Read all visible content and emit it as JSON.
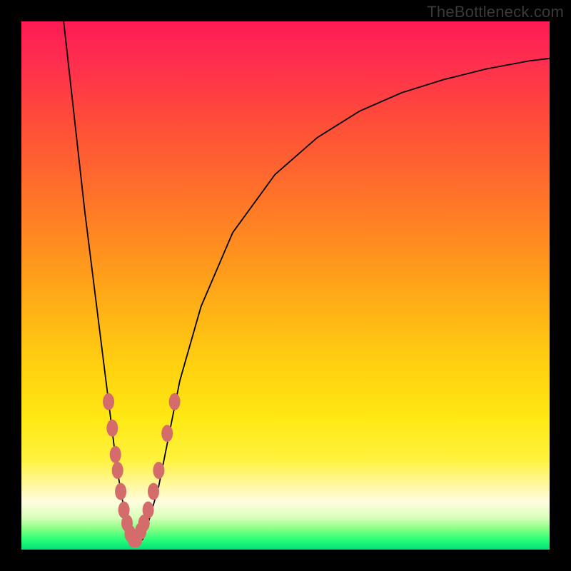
{
  "watermark_text": "TheBottleneck.com",
  "chart_data": {
    "type": "line",
    "title": "",
    "xlabel": "",
    "ylabel": "",
    "xlim": [
      0,
      100
    ],
    "ylim": [
      0,
      100
    ],
    "series": [
      {
        "name": "bottleneck-curve",
        "x": [
          8,
          10,
          12,
          14,
          16,
          17,
          18,
          19,
          20,
          21,
          22,
          23,
          24,
          26,
          28,
          30,
          34,
          40,
          48,
          56,
          64,
          72,
          80,
          88,
          96,
          100
        ],
        "values": [
          100,
          82,
          64,
          48,
          32,
          24,
          16,
          10,
          5,
          2,
          1,
          2,
          5,
          12,
          22,
          32,
          46,
          60,
          71,
          78,
          83,
          86.5,
          89,
          91,
          92.5,
          93
        ]
      }
    ],
    "markers": {
      "name": "highlight-points",
      "x": [
        16.5,
        17.2,
        17.8,
        18.2,
        18.8,
        19.4,
        20.0,
        20.6,
        21.2,
        21.8,
        22.6,
        23.2,
        24.0,
        25.0,
        26.0,
        27.6,
        29.0
      ],
      "values": [
        28,
        23,
        18,
        15,
        11,
        7.5,
        5,
        3,
        2,
        2,
        3.5,
        5,
        7.5,
        11,
        15,
        22,
        28
      ]
    },
    "gradient_stops": [
      {
        "pct": 0,
        "color": "#ff1a55"
      },
      {
        "pct": 18,
        "color": "#ff4a3a"
      },
      {
        "pct": 42,
        "color": "#ff8c1f"
      },
      {
        "pct": 65,
        "color": "#ffd010"
      },
      {
        "pct": 88,
        "color": "#fff8a5"
      },
      {
        "pct": 96,
        "color": "#8cff86"
      },
      {
        "pct": 100,
        "color": "#00e074"
      }
    ]
  }
}
